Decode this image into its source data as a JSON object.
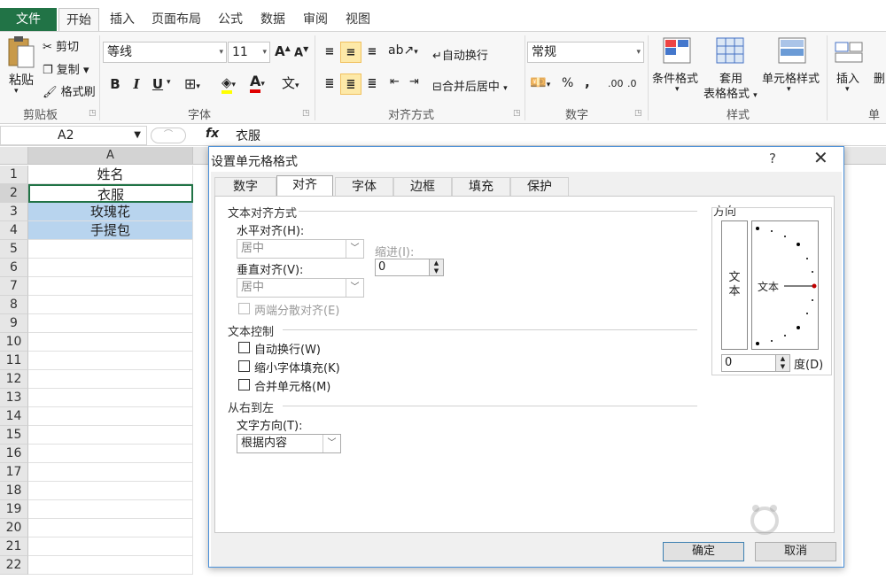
{
  "tabs": {
    "file": "文件",
    "home": "开始",
    "insert": "插入",
    "layout": "页面布局",
    "formula": "公式",
    "data": "数据",
    "review": "审阅",
    "view": "视图"
  },
  "ribbon": {
    "clipboard": {
      "paste": "粘贴",
      "cut": "剪切",
      "copy": "复制",
      "format_painter": "格式刷",
      "label": "剪贴板"
    },
    "font": {
      "name": "等线",
      "size": "11",
      "bold": "B",
      "italic": "I",
      "underline": "U",
      "label": "字体"
    },
    "alignment": {
      "wrap": "自动换行",
      "merge": "合并后居中",
      "label": "对齐方式"
    },
    "number": {
      "format": "常规",
      "percent": "%",
      "comma": ",",
      "label": "数字"
    },
    "styles": {
      "conditional": "条件格式",
      "table_line1": "套用",
      "table_line2": "表格格式",
      "cell_style": "单元格样式",
      "label": "样式"
    },
    "cells": {
      "insert": "插入",
      "label": "单元"
    }
  },
  "formula_bar": {
    "name_box": "A2",
    "fx": "fx",
    "content": "衣服"
  },
  "grid": {
    "col_a": "A",
    "rows": [
      "1",
      "2",
      "3",
      "4",
      "5",
      "6",
      "7",
      "8",
      "9",
      "10",
      "11",
      "12",
      "13",
      "14",
      "15",
      "16",
      "17",
      "18",
      "19",
      "20",
      "21",
      "22"
    ],
    "cells": [
      "姓名",
      "衣服",
      "玫瑰花",
      "手提包"
    ]
  },
  "dialog": {
    "title": "设置单元格格式",
    "help": "?",
    "close": "✕",
    "tabs": [
      "数字",
      "对齐",
      "字体",
      "边框",
      "填充",
      "保护"
    ],
    "alignment_section": "文本对齐方式",
    "horizontal_label": "水平对齐(H):",
    "horizontal_value": "居中",
    "indent_label": "缩进(I):",
    "indent_value": "0",
    "vertical_label": "垂直对齐(V):",
    "vertical_value": "居中",
    "distributed_label": "两端分散对齐(E)",
    "control_section": "文本控制",
    "wrap_label": "自动换行(W)",
    "shrink_label": "缩小字体填充(K)",
    "merge_label": "合并单元格(M)",
    "rtl_section": "从右到左",
    "direction_label": "文字方向(T):",
    "direction_value": "根据内容",
    "orientation_title": "方向",
    "vertical_text": "文本",
    "arc_text": "文本",
    "degree_value": "0",
    "degree_label": "度(D)",
    "ok": "确定",
    "cancel": "取消"
  },
  "colors": {
    "accent": "#217346",
    "highlight": "#b8d4ee",
    "annotation": "#e00000"
  }
}
